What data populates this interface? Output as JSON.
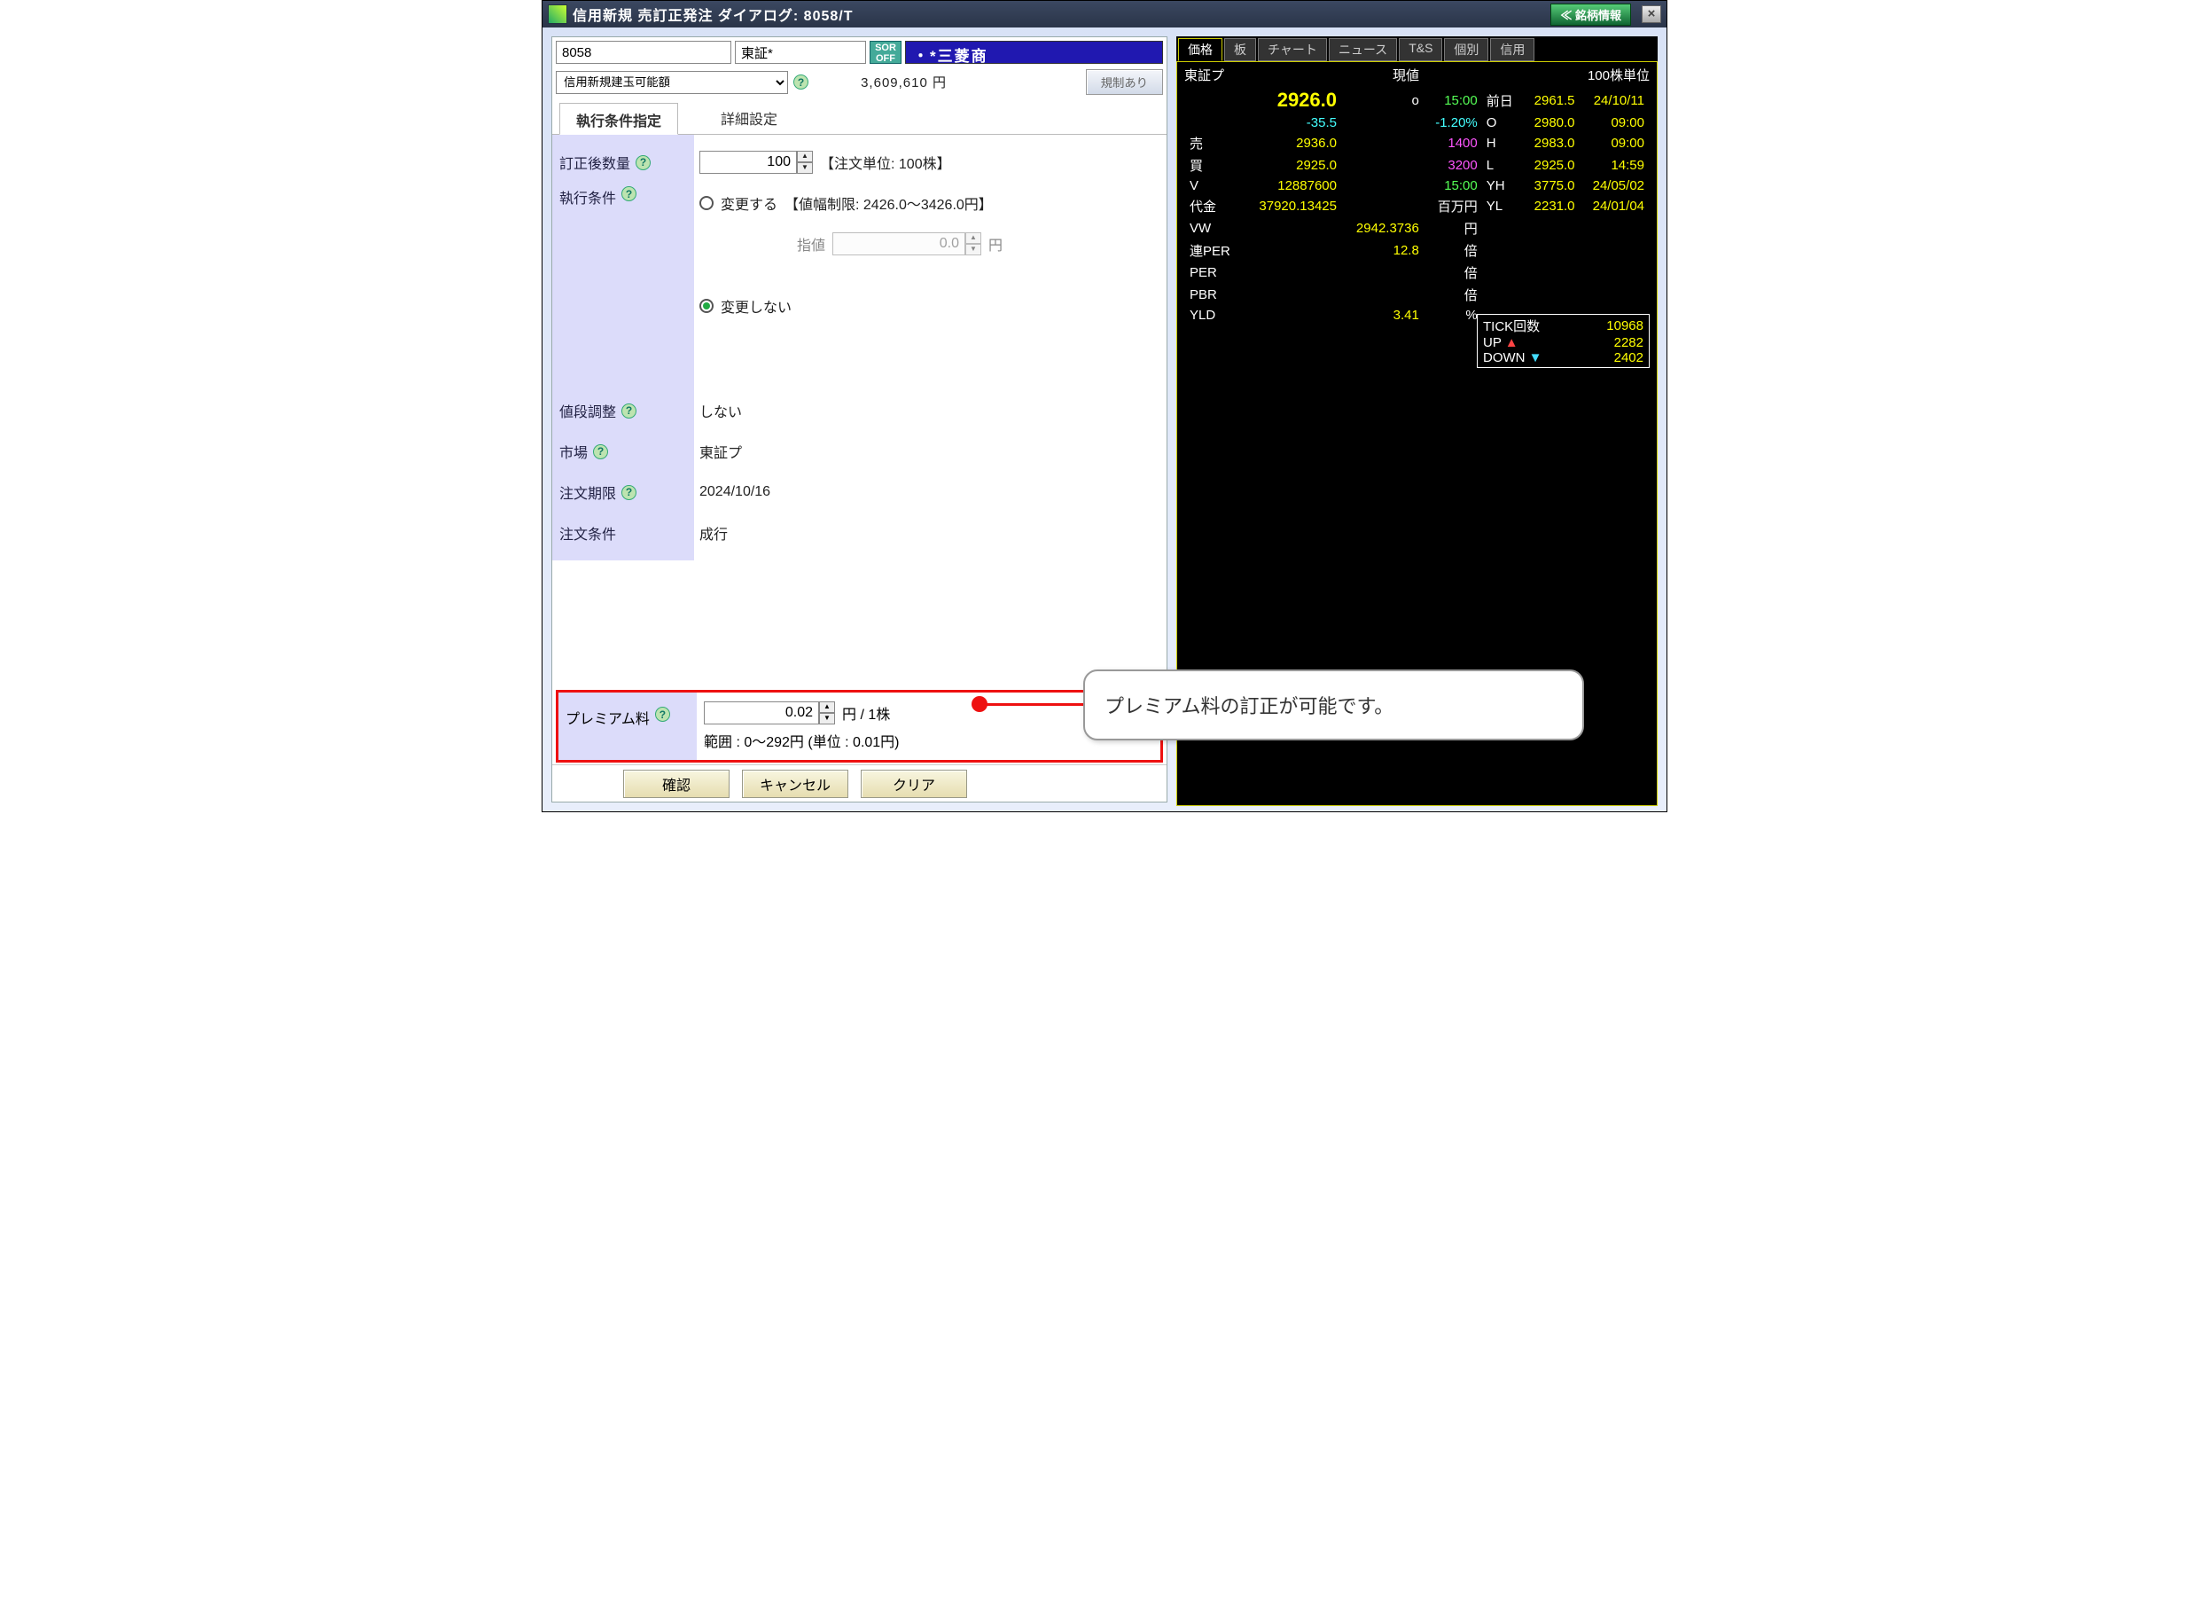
{
  "titlebar": {
    "title": "信用新規 売訂正発注 ダイアログ: 8058/T",
    "stock_info_btn": "≪ 銘柄情報",
    "close": "×"
  },
  "left": {
    "code": "8058",
    "exchange": "東証*",
    "sor": "SOR\nOFF",
    "stock_name": "・*三菱商",
    "select_label": "信用新規建玉可能額",
    "amount": "3,609,610 円",
    "restrict_btn": "規制あり",
    "tabs": {
      "exec": "執行条件指定",
      "detail": "詳細設定"
    },
    "labels": {
      "qty": "訂正後数量",
      "cond": "執行条件",
      "price_adj": "値段調整",
      "market": "市場",
      "expire": "注文期限",
      "order_cond": "注文条件",
      "premium": "プレミアム料"
    },
    "vals": {
      "qty": "100",
      "qty_unit": "【注文単位: 100株】",
      "change_yes": "変更する",
      "limit_range": "【値幅制限: 2426.0～3426.0円】",
      "limit_label": "指値",
      "limit_val": "0.0",
      "yen": "円",
      "change_no": "変更しない",
      "price_adj": "しない",
      "market": "東証プ",
      "expire": "2024/10/16",
      "order_cond": "成行",
      "premium_val": "0.02",
      "premium_unit": "円 / 1株",
      "premium_range": "範囲 : 0～292円 (単位 : 0.01円)"
    },
    "buttons": {
      "confirm": "確認",
      "cancel": "キャンセル",
      "clear": "クリア"
    }
  },
  "right": {
    "tabs": [
      "価格",
      "板",
      "チャート",
      "ニュース",
      "T&S",
      "個別",
      "信用"
    ],
    "head": {
      "l": "東証プ",
      "c": "現値",
      "r": "100株単位"
    },
    "rows": [
      [
        "",
        "2926.0",
        "o",
        "15:00",
        "前日",
        "2961.5",
        "24/10/11"
      ],
      [
        "",
        "-35.5",
        "",
        "-1.20%",
        "O",
        "2980.0",
        "09:00"
      ],
      [
        "売",
        "2936.0",
        "",
        "1400",
        "H",
        "2983.0",
        "09:00"
      ],
      [
        "買",
        "2925.0",
        "",
        "3200",
        "L",
        "2925.0",
        "14:59"
      ],
      [
        "V",
        "12887600",
        "",
        "15:00",
        "YH",
        "3775.0",
        "24/05/02"
      ],
      [
        "代金",
        "37920.13425",
        "",
        "百万円",
        "YL",
        "2231.0",
        "24/01/04"
      ],
      [
        "VW",
        "",
        "2942.3736",
        "円",
        "",
        "",
        ""
      ],
      [
        "連PER",
        "",
        "12.8",
        "倍",
        "",
        "",
        ""
      ],
      [
        "PER",
        "",
        "",
        "倍",
        "",
        "",
        ""
      ],
      [
        "PBR",
        "",
        "",
        "倍",
        "",
        "",
        ""
      ],
      [
        "YLD",
        "",
        "3.41",
        "%",
        "",
        "",
        ""
      ]
    ],
    "tick": {
      "label": "TICK回数",
      "count": "10968",
      "up_l": "UP",
      "up": "2282",
      "down_l": "DOWN",
      "down": "2402"
    }
  },
  "callout": "プレミアム料の訂正が可能です。"
}
